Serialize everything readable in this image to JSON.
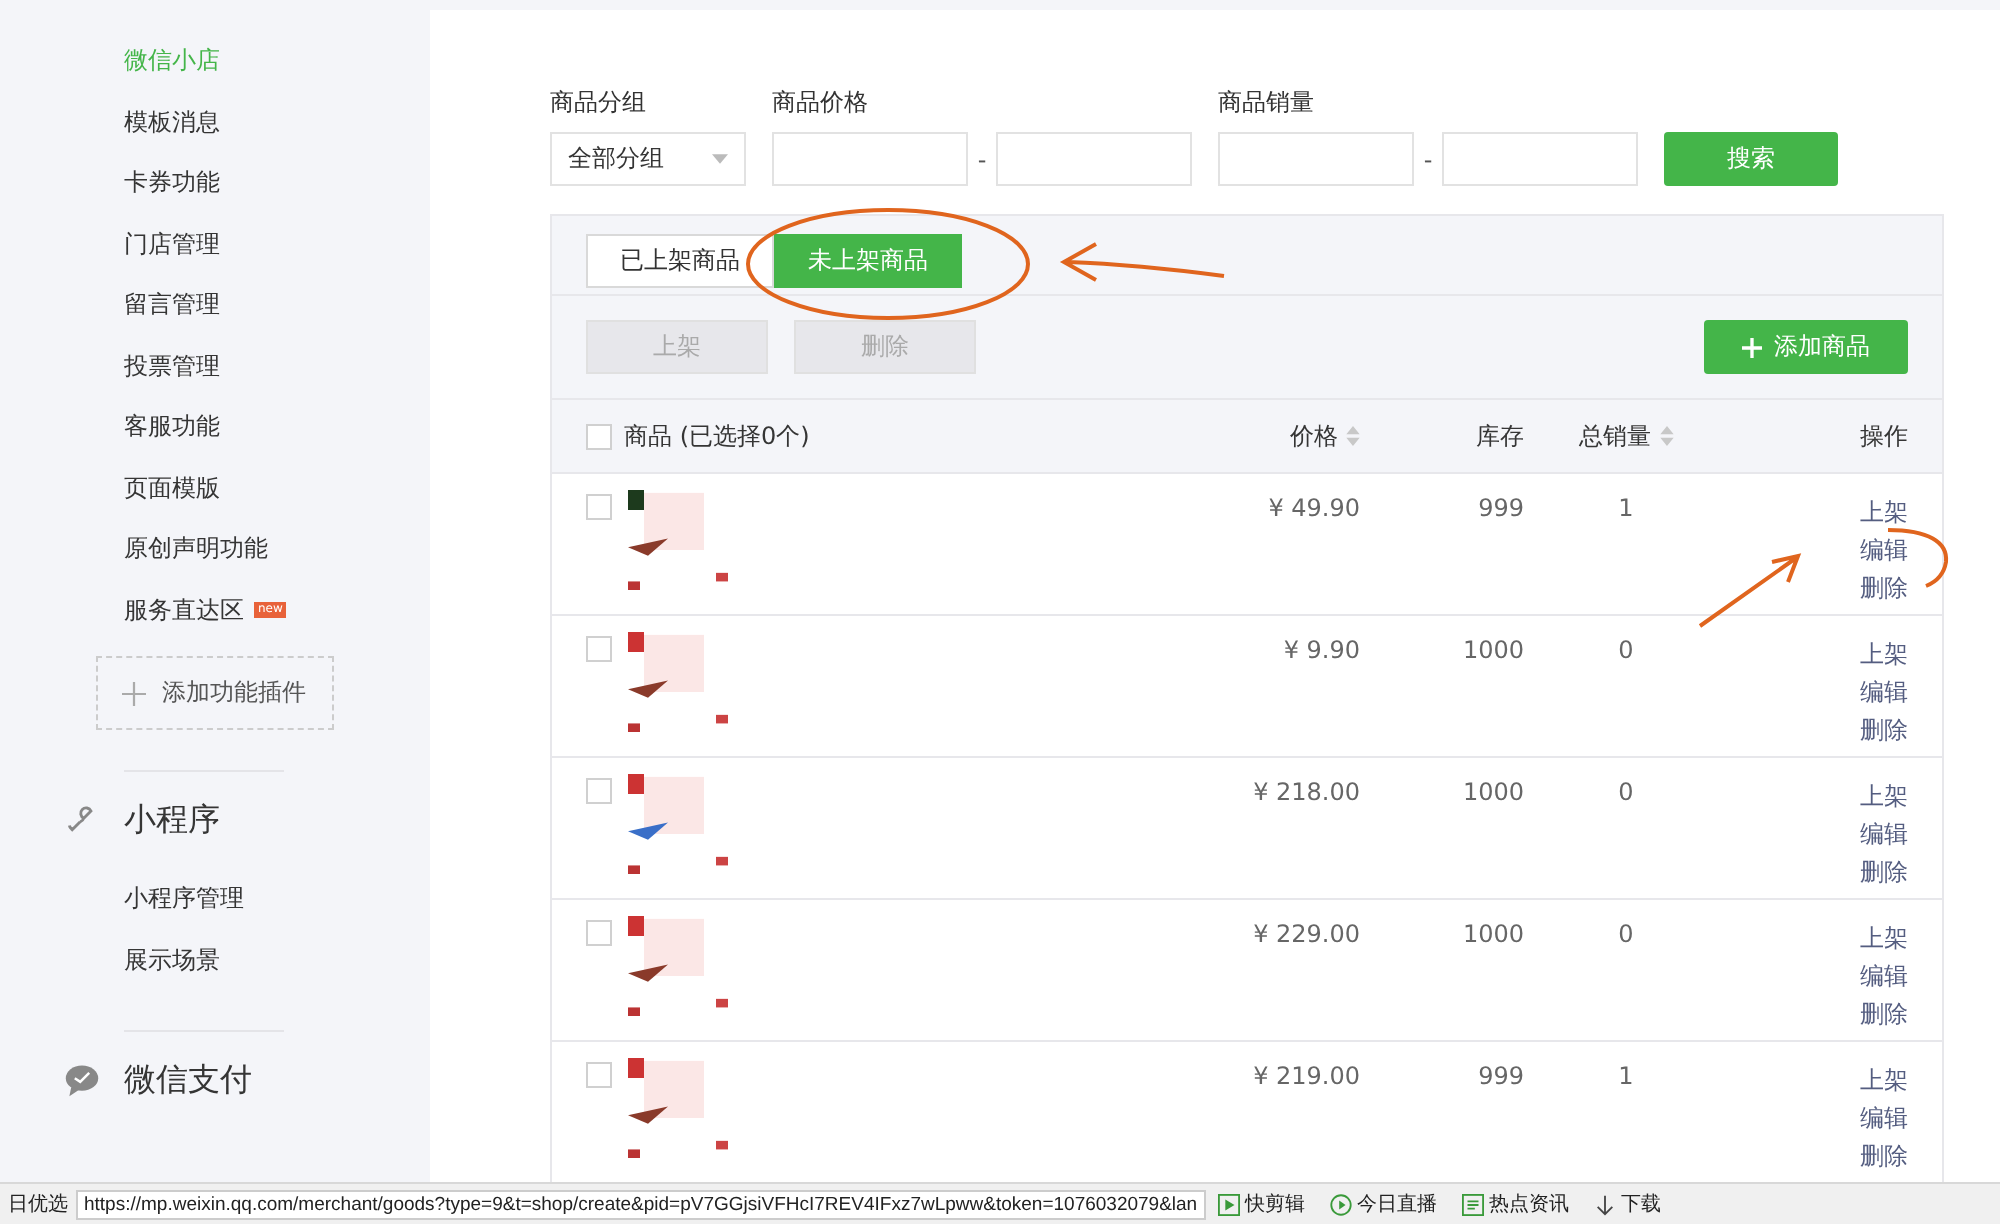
{
  "sidebar": {
    "items": [
      {
        "label": "微信小店",
        "selected": true
      },
      {
        "label": "模板消息",
        "selected": false
      },
      {
        "label": "卡券功能",
        "selected": false
      },
      {
        "label": "门店管理",
        "selected": false
      },
      {
        "label": "留言管理",
        "selected": false
      },
      {
        "label": "投票管理",
        "selected": false
      },
      {
        "label": "客服功能",
        "selected": false
      },
      {
        "label": "页面模版",
        "selected": false
      },
      {
        "label": "原创声明功能",
        "selected": false
      },
      {
        "label": "服务直达区",
        "selected": false,
        "badge": "new"
      }
    ],
    "add_plugin": "添加功能插件",
    "sections": [
      {
        "title": "小程序",
        "kind": "link",
        "items": [
          "小程序管理",
          "展示场景"
        ]
      },
      {
        "title": "微信支付",
        "kind": "chat"
      }
    ]
  },
  "filters": {
    "group_label": "商品分组",
    "group_value": "全部分组",
    "price_label": "商品价格",
    "sales_label": "商品销量",
    "dash": "-",
    "search_button": "搜索"
  },
  "tabs": [
    {
      "label": "已上架商品",
      "selected": false
    },
    {
      "label": "未上架商品",
      "selected": true
    }
  ],
  "actions": [
    {
      "label": "上架",
      "disabled": true
    },
    {
      "label": "删除",
      "disabled": true
    }
  ],
  "add_button": "添加商品",
  "table": {
    "select_all_checked": false,
    "columns": [
      "商品 (已选择0个)",
      "价格",
      "库存",
      "总销量",
      "操作"
    ],
    "rows": [
      {
        "checked": false,
        "price": "¥ 49.90",
        "stock": "999",
        "sales": "1",
        "ops": [
          "上架",
          "编辑",
          "删除"
        ]
      },
      {
        "checked": false,
        "price": "¥ 9.90",
        "stock": "1000",
        "sales": "0",
        "ops": [
          "上架",
          "编辑",
          "删除"
        ]
      },
      {
        "checked": false,
        "price": "¥ 218.00",
        "stock": "1000",
        "sales": "0",
        "ops": [
          "上架",
          "编辑",
          "删除"
        ]
      },
      {
        "checked": false,
        "price": "¥ 229.00",
        "stock": "1000",
        "sales": "0",
        "ops": [
          "上架",
          "编辑",
          "删除"
        ]
      },
      {
        "checked": false,
        "price": "¥ 219.00",
        "stock": "999",
        "sales": "1",
        "ops": [
          "上架",
          "编辑",
          "删除"
        ]
      }
    ]
  },
  "status_bar": {
    "left": "日优选",
    "url": "https://mp.weixin.qq.com/merchant/goods?type=9&t=shop/create&pid=pV7GGjsiVFHcI7REV4IFxz7wLpww&token=1076032079&lan",
    "items": [
      {
        "label": "快剪辑",
        "kind": "play"
      },
      {
        "label": "今日直播",
        "kind": "live"
      },
      {
        "label": "热点资讯",
        "kind": "news"
      },
      {
        "label": "下载",
        "kind": "download"
      }
    ]
  }
}
